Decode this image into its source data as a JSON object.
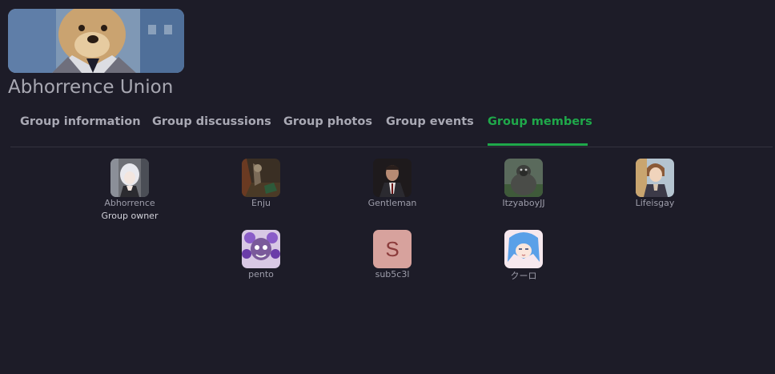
{
  "group": {
    "name": "Abhorrence Union"
  },
  "tabs": [
    {
      "label": "Group information"
    },
    {
      "label": "Group discussions"
    },
    {
      "label": "Group photos"
    },
    {
      "label": "Group events"
    },
    {
      "label": "Group members",
      "active": true
    }
  ],
  "members": [
    {
      "name": "Abhorrence",
      "role": "Group owner"
    },
    {
      "name": "Enju"
    },
    {
      "name": "Gentleman"
    },
    {
      "name": "ItzyaboyJJ"
    },
    {
      "name": "Lifeisgay"
    },
    {
      "name": "pento"
    },
    {
      "name": "sub5c3l",
      "avatar_letter": "S"
    },
    {
      "name": "クーロ"
    }
  ],
  "colors": {
    "background": "#1d1c28",
    "accent": "#1fa84a",
    "tab_text": "#a9a9b4",
    "letter_avatar_bg": "#d7a29d"
  }
}
